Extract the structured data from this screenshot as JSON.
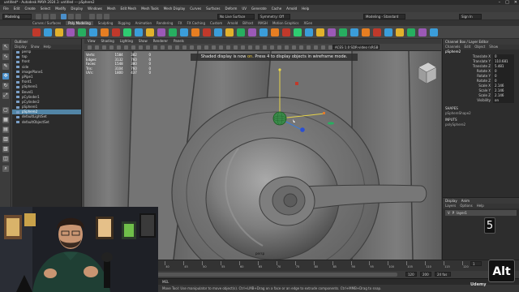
{
  "titlebar": {
    "text": "untitled* - Autodesk MAYA 2024.1: untitled  ---  pSphere2"
  },
  "window_controls": [
    "–",
    "□",
    "✕"
  ],
  "menubar": [
    "File",
    "Edit",
    "Create",
    "Select",
    "Modify",
    "Display",
    "Windows",
    "Mesh",
    "Edit Mesh",
    "Mesh Tools",
    "Mesh Display",
    "Curves",
    "Surfaces",
    "Deform",
    "UV",
    "Generate",
    "Cache",
    "Arnold",
    "Help"
  ],
  "status": {
    "mode": "Modeling",
    "live_surface": "No Live Surface",
    "symmetry": "Symmetry: Off",
    "workspace": "Modeling - Standard",
    "signin": "Sign In"
  },
  "shelf_tabs": [
    "Curves / Surfaces",
    "Poly Modeling",
    "Sculpting",
    "Rigging",
    "Animation",
    "Rendering",
    "FX",
    "FX Caching",
    "Custom",
    "Arnold",
    "Bifrost",
    "MASH",
    "Motion Graphics",
    "XGen"
  ],
  "shelf_active": "Poly Modeling",
  "shelf_colors": [
    "#c0392b",
    "#3b9dd9",
    "#e1b12c",
    "#9b59b6",
    "#27ae60",
    "#3b9dd9",
    "#e67e22",
    "#c0392b",
    "#2ecc71",
    "#3b9dd9",
    "#e1b12c",
    "#9b59b6",
    "#27ae60",
    "#3b9dd9",
    "#e67e22",
    "#c0392b",
    "#3b9dd9",
    "#e1b12c",
    "#27ae60",
    "#9b59b6",
    "#3b9dd9",
    "#e67e22",
    "#c0392b",
    "#2ecc71",
    "#3b9dd9",
    "#e1b12c",
    "#9b59b6",
    "#27ae60",
    "#3b9dd9",
    "#e67e22",
    "#c0392b",
    "#3b9dd9",
    "#e1b12c",
    "#27ae60",
    "#9b59b6",
    "#3b9dd9"
  ],
  "outliner": {
    "title": "Outliner",
    "menus": [
      "Display",
      "Show",
      "Help"
    ],
    "items": [
      "persp",
      "top",
      "front",
      "side",
      "imagePlane1",
      "pPipe1",
      "front1",
      "pSphere1",
      "Bevel1",
      "pCylinder1",
      "pCylinder2",
      "pSphere1",
      "pSphere2",
      "defaultLightSet",
      "defaultObjectSet"
    ],
    "selected_index": 12
  },
  "viewport": {
    "menus": [
      "View",
      "Shading",
      "Lighting",
      "Show",
      "Renderer",
      "Panels"
    ],
    "hud": [
      {
        "k": "Verts:",
        "v1": "1584",
        "v2": "382",
        "v3": "0"
      },
      {
        "k": "Edges:",
        "v1": "3132",
        "v2": "760",
        "v3": "0"
      },
      {
        "k": "Faces:",
        "v1": "1548",
        "v2": "380",
        "v3": "0"
      },
      {
        "k": "Tris:",
        "v1": "3104",
        "v2": "760",
        "v3": "0"
      },
      {
        "k": "UVs:",
        "v1": "1800",
        "v2": "437",
        "v3": "0"
      }
    ],
    "message_before": "Shaded display is now ",
    "message_on": "on",
    "message_after": ". Press 4 to display objects in wireframe mode.",
    "camera_label": "persp",
    "color_space": "ACES 1.0 SDR-video (sRGB)"
  },
  "channelbox": {
    "tabs": [
      "Channel Box / Layer Editor"
    ],
    "menus": [
      "Channels",
      "Edit",
      "Object",
      "Show"
    ],
    "object": "pSphere2",
    "attributes": [
      {
        "name": "Translate X",
        "value": "0"
      },
      {
        "name": "Translate Y",
        "value": "110.681"
      },
      {
        "name": "Translate Z",
        "value": "5.481"
      },
      {
        "name": "Rotate X",
        "value": "0"
      },
      {
        "name": "Rotate Y",
        "value": "0"
      },
      {
        "name": "Rotate Z",
        "value": "0"
      },
      {
        "name": "Scale X",
        "value": "2.146"
      },
      {
        "name": "Scale Y",
        "value": "2.146"
      },
      {
        "name": "Scale Z",
        "value": "2.146"
      },
      {
        "name": "Visibility",
        "value": "on"
      }
    ],
    "shapes_label": "SHAPES",
    "shape_name": "pSphereShape2",
    "inputs_label": "INPUTS",
    "input_name": "polySphere2"
  },
  "layers": {
    "tabs": [
      "Display",
      "Anim"
    ],
    "menus": [
      "Layers",
      "Options",
      "Help"
    ],
    "rows": [
      {
        "v": "V",
        "p": "P",
        "name": "layer1"
      }
    ]
  },
  "timeslider": {
    "ticks": [
      "1",
      "5",
      "10",
      "15",
      "20",
      "25",
      "30",
      "35",
      "40",
      "45",
      "50",
      "55",
      "60",
      "65",
      "70",
      "75",
      "80",
      "85",
      "90",
      "95",
      "100",
      "105",
      "110",
      "115",
      "120"
    ],
    "current_frame": "1",
    "range_start": "1",
    "range_end": "120",
    "anim_end": "200",
    "fps": "24 fps",
    "character_set": "No Character Set",
    "anim_layer": "No Anim Layer"
  },
  "command_line": {
    "label": "MEL"
  },
  "help_line": "Move Tool: Use manipulator to move object(s). Ctrl+LMB+Drag on a face or an edge to extrude components. Ctrl+MMB+Drag to snap.",
  "overlay": {
    "key_badge": "5",
    "alt_badge": "Alt",
    "watermark": "Udemy"
  }
}
